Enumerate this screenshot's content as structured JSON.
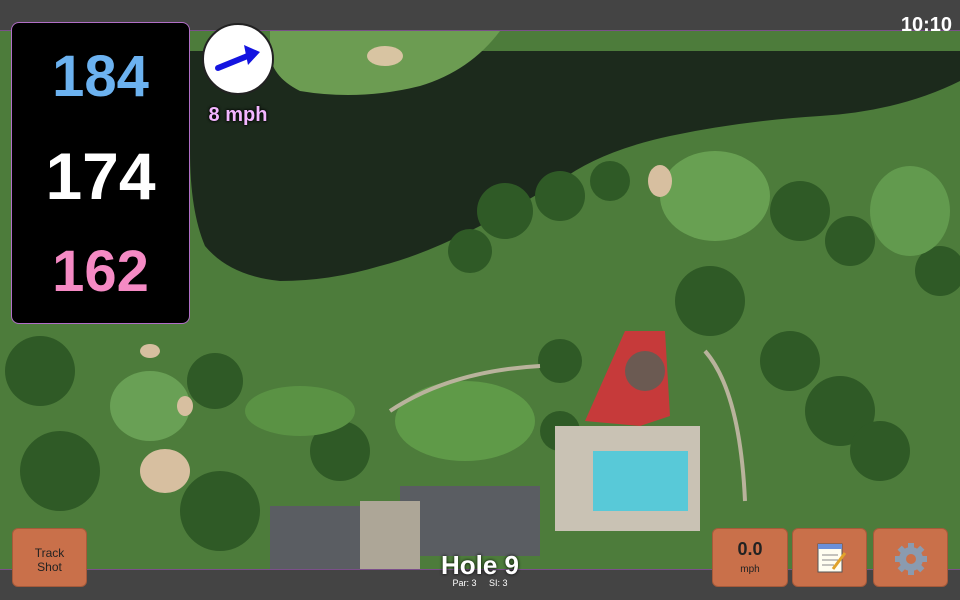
{
  "status": {
    "time": "10:10"
  },
  "yardages": {
    "back": "184",
    "center": "174",
    "front": "162"
  },
  "colors": {
    "back": "#6cb2f0",
    "center": "#ffffff",
    "front": "#f58ac4",
    "button": "#c9704a",
    "accent_border": "#7b4f8a"
  },
  "wind": {
    "speed": "8 mph",
    "icon": "wind-arrow-icon"
  },
  "buttons": {
    "track_shot": "Track\nShot",
    "speed_value": "0.0",
    "speed_unit": "mph",
    "notes_icon": "notepad-icon",
    "settings_icon": "gear-icon"
  },
  "hole": {
    "title": "Hole 9",
    "par": "Par: 3",
    "si": "SI: 3"
  }
}
